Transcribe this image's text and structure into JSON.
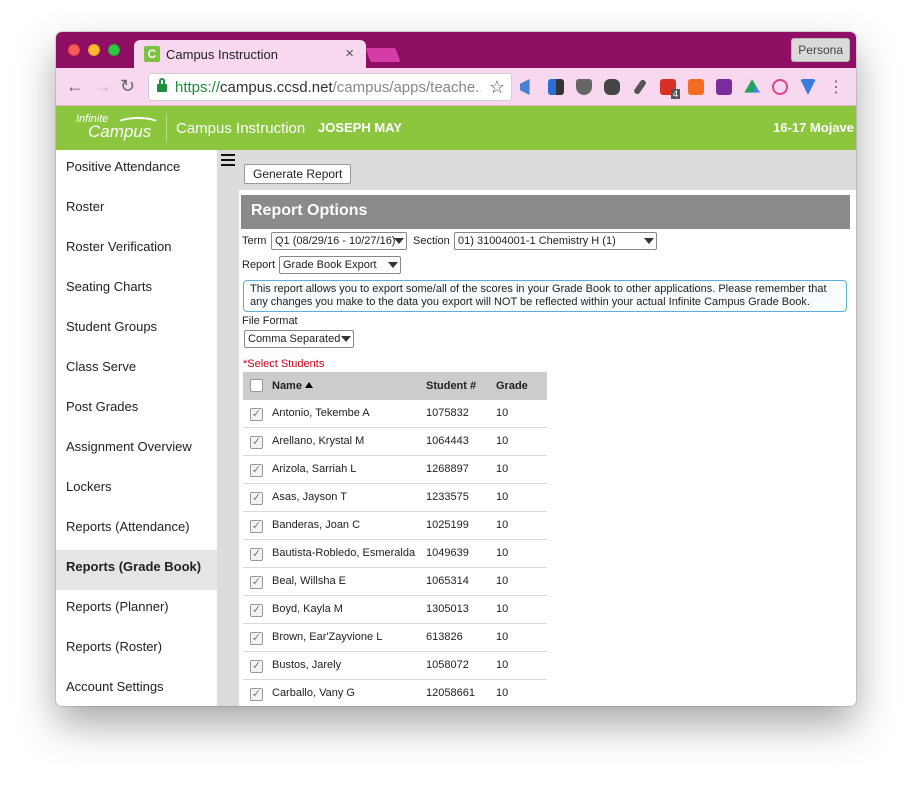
{
  "browser": {
    "tab_title": "Campus Instruction",
    "tab_close": "×",
    "profile_label": "Persona",
    "url_scheme": "https://",
    "url_host": "campus.ccsd.net",
    "url_path": "/campus/apps/teache...",
    "back_glyph": "←",
    "forward_glyph": "→",
    "reload_glyph": "↻",
    "star_glyph": "☆",
    "menu_glyph": "⋮",
    "favicon_letter": "C",
    "extensions": [
      "megaphone-icon",
      "dropbox-icon",
      "pocket-icon",
      "evernote-icon",
      "pen-icon",
      "calendar-icon",
      "hangouts-icon",
      "onenote-icon",
      "drive-icon",
      "atom-icon",
      "vpn-icon"
    ],
    "extension_badge": "4"
  },
  "app": {
    "logo_top": "Infinite",
    "logo_bottom": "Campus",
    "app_name": "Campus Instruction",
    "user_name": "JOSEPH MAY",
    "school_year": "16-17 Mojave"
  },
  "sidebar": {
    "items": [
      {
        "label": "Positive Attendance"
      },
      {
        "label": "Roster"
      },
      {
        "label": "Roster Verification"
      },
      {
        "label": "Seating Charts"
      },
      {
        "label": "Student Groups"
      },
      {
        "label": "Class Serve"
      },
      {
        "label": "Post Grades"
      },
      {
        "label": "Assignment Overview"
      },
      {
        "label": "Lockers"
      },
      {
        "label": "Reports (Attendance)"
      },
      {
        "label": "Reports (Grade Book)",
        "active": true
      },
      {
        "label": "Reports (Planner)"
      },
      {
        "label": "Reports (Roster)"
      },
      {
        "label": "Account Settings"
      }
    ]
  },
  "main": {
    "generate_button": "Generate Report",
    "panel_title": "Report Options",
    "term_label": "Term",
    "term_value": "Q1 (08/29/16 - 10/27/16)",
    "section_label": "Section",
    "section_value": "01) 31004001-1 Chemistry H (1)",
    "report_label": "Report",
    "report_value": "Grade Book Export",
    "info_text": "This report allows you to export some/all of the scores in your Grade Book to other applications. Please remember that any changes you make to the data you export will NOT be reflected within your actual Infinite Campus Grade Book.",
    "file_format_label": "File Format",
    "file_format_value": "Comma Separated",
    "select_students_label": "*Select Students",
    "columns": {
      "name": "Name",
      "student_num": "Student #",
      "grade": "Grade"
    },
    "check_glyph": "✓",
    "students": [
      {
        "name": "Antonio, Tekembe A",
        "student_num": "1075832",
        "grade": "10"
      },
      {
        "name": "Arellano, Krystal M",
        "student_num": "1064443",
        "grade": "10"
      },
      {
        "name": "Arizola, Sarriah L",
        "student_num": "1268897",
        "grade": "10"
      },
      {
        "name": "Asas, Jayson T",
        "student_num": "1233575",
        "grade": "10"
      },
      {
        "name": "Banderas, Joan C",
        "student_num": "1025199",
        "grade": "10"
      },
      {
        "name": "Bautista-Robledo, Esmeralda",
        "student_num": "1049639",
        "grade": "10"
      },
      {
        "name": "Beal, Willsha E",
        "student_num": "1065314",
        "grade": "10"
      },
      {
        "name": "Boyd, Kayla M",
        "student_num": "1305013",
        "grade": "10"
      },
      {
        "name": "Brown, Ear'Zayvione L",
        "student_num": "613826",
        "grade": "10"
      },
      {
        "name": "Bustos, Jarely",
        "student_num": "1058072",
        "grade": "10"
      },
      {
        "name": "Carballo, Vany G",
        "student_num": "12058661",
        "grade": "10"
      }
    ]
  }
}
